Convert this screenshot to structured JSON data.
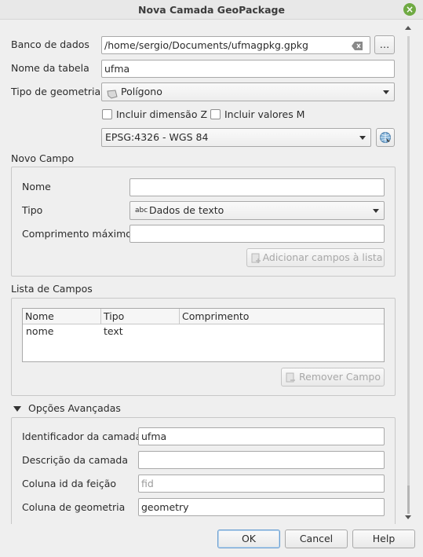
{
  "window": {
    "title": "Nova Camada GeoPackage"
  },
  "database": {
    "label": "Banco de dados",
    "value": "/home/sergio/Documents/ufmagpkg.gpkg",
    "browse_label": "…"
  },
  "table_name": {
    "label": "Nome da tabela",
    "value": "ufma"
  },
  "geometry_type": {
    "label": "Tipo de geometria",
    "value": "Polígono"
  },
  "options": {
    "z_label": "Incluir dimensão Z",
    "m_label": "Incluir valores M"
  },
  "crs": {
    "value": "EPSG:4326 - WGS 84"
  },
  "new_field": {
    "title": "Novo Campo",
    "name_label": "Nome",
    "name_value": "",
    "type_label": "Tipo",
    "type_icon_text": "abc",
    "type_value": "Dados de texto",
    "maxlen_label": "Comprimento máximo",
    "maxlen_value": "",
    "add_button": "Adicionar campos à lista"
  },
  "fields_list": {
    "title": "Lista de Campos",
    "columns": [
      "Nome",
      "Tipo",
      "Comprimento"
    ],
    "rows": [
      {
        "name": "nome",
        "type": "text",
        "length": ""
      }
    ],
    "remove_button": "Remover Campo"
  },
  "advanced": {
    "title": "Opções Avançadas",
    "layer_id_label": "Identificador da camada",
    "layer_id_value": "ufma",
    "layer_desc_label": "Descrição da camada",
    "layer_desc_value": "",
    "fid_label": "Coluna id da feição",
    "fid_placeholder": "fid",
    "geom_col_label": "Coluna de geometria",
    "geom_col_value": "geometry"
  },
  "buttons": {
    "ok": "OK",
    "cancel": "Cancel",
    "help": "Help"
  },
  "colors": {
    "close_button": "#6faa43"
  }
}
